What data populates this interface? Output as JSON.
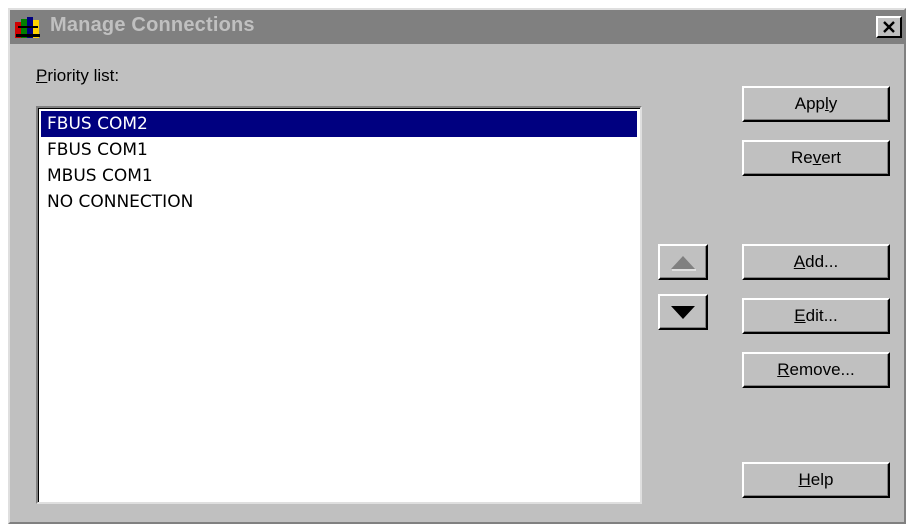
{
  "window": {
    "title": "Manage Connections",
    "close_glyph": "×",
    "icon": "colorful-books-icon"
  },
  "priority_list": {
    "label_first_letter": "P",
    "label_rest": "riority list:",
    "items": [
      {
        "label": "FBUS COM2",
        "selected": true
      },
      {
        "label": "FBUS COM1",
        "selected": false
      },
      {
        "label": "MBUS COM1",
        "selected": false
      },
      {
        "label": "NO CONNECTION",
        "selected": false
      }
    ]
  },
  "buttons": {
    "apply": {
      "pre": "App",
      "key": "l",
      "post": "y"
    },
    "revert": {
      "pre": "Re",
      "key": "v",
      "post": "ert"
    },
    "add": {
      "pre": "",
      "key": "A",
      "post": "dd..."
    },
    "edit": {
      "pre": "",
      "key": "E",
      "post": "dit..."
    },
    "remove": {
      "pre": "",
      "key": "R",
      "post": "emove..."
    },
    "help": {
      "pre": "",
      "key": "H",
      "post": "elp"
    }
  },
  "arrows": {
    "up_icon": "arrow-up-icon",
    "down_icon": "arrow-down-icon",
    "up_enabled": false,
    "down_enabled": true
  },
  "colors": {
    "face": "#c0c0c0",
    "selection": "#000080",
    "title_inactive": "#808080"
  }
}
